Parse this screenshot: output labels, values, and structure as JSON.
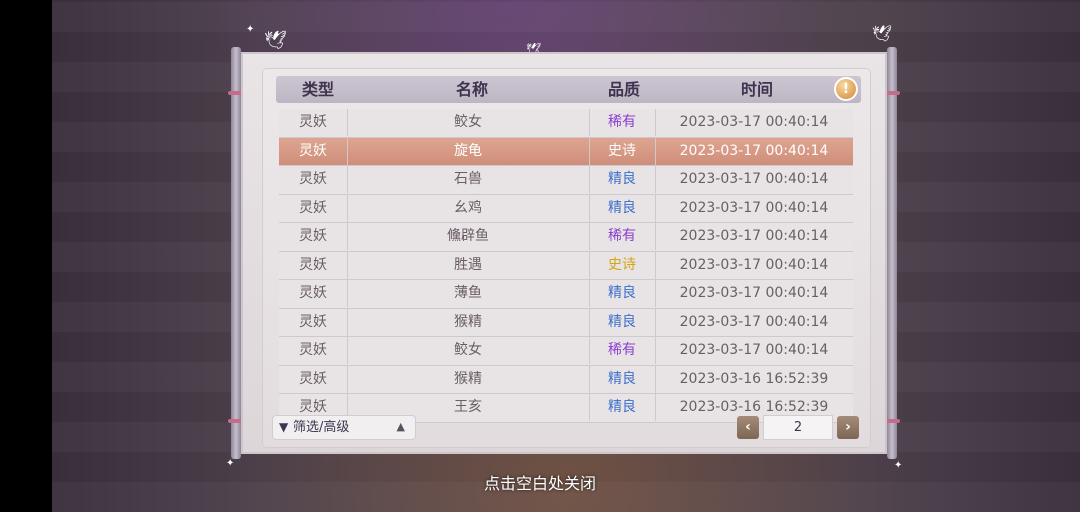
{
  "header": {
    "col_type": "类型",
    "col_name": "名称",
    "col_quality": "品质",
    "col_time": "时间",
    "info_icon": "!"
  },
  "quality_colors": {
    "稀有": "#8a3fd0",
    "史诗": "#d4a514",
    "精良": "#3f6fcc"
  },
  "rows": [
    {
      "type": "灵妖",
      "name": "鲛女",
      "quality": "稀有",
      "time": "2023-03-17  00:40:14",
      "highlighted": false
    },
    {
      "type": "灵妖",
      "name": "旋龟",
      "quality": "史诗",
      "time": "2023-03-17  00:40:14",
      "highlighted": true
    },
    {
      "type": "灵妖",
      "name": "石兽",
      "quality": "精良",
      "time": "2023-03-17  00:40:14",
      "highlighted": false
    },
    {
      "type": "灵妖",
      "name": "幺鸡",
      "quality": "精良",
      "time": "2023-03-17  00:40:14",
      "highlighted": false
    },
    {
      "type": "灵妖",
      "name": "儵辟鱼",
      "quality": "稀有",
      "time": "2023-03-17  00:40:14",
      "highlighted": false
    },
    {
      "type": "灵妖",
      "name": "胜遇",
      "quality": "史诗",
      "time": "2023-03-17  00:40:14",
      "highlighted": false
    },
    {
      "type": "灵妖",
      "name": "薄鱼",
      "quality": "精良",
      "time": "2023-03-17  00:40:14",
      "highlighted": false
    },
    {
      "type": "灵妖",
      "name": "猴精",
      "quality": "精良",
      "time": "2023-03-17  00:40:14",
      "highlighted": false
    },
    {
      "type": "灵妖",
      "name": "鲛女",
      "quality": "稀有",
      "time": "2023-03-17  00:40:14",
      "highlighted": false
    },
    {
      "type": "灵妖",
      "name": "猴精",
      "quality": "精良",
      "time": "2023-03-16  16:52:39",
      "highlighted": false
    },
    {
      "type": "灵妖",
      "name": "王亥",
      "quality": "精良",
      "time": "2023-03-16  16:52:39",
      "highlighted": false
    }
  ],
  "filter": {
    "label": "筛选/高级",
    "icon": "filter-icon",
    "arrow": "▲"
  },
  "pagination": {
    "prev": "‹",
    "next": "›",
    "page": "2"
  },
  "close_hint": "点击空白处关闭"
}
